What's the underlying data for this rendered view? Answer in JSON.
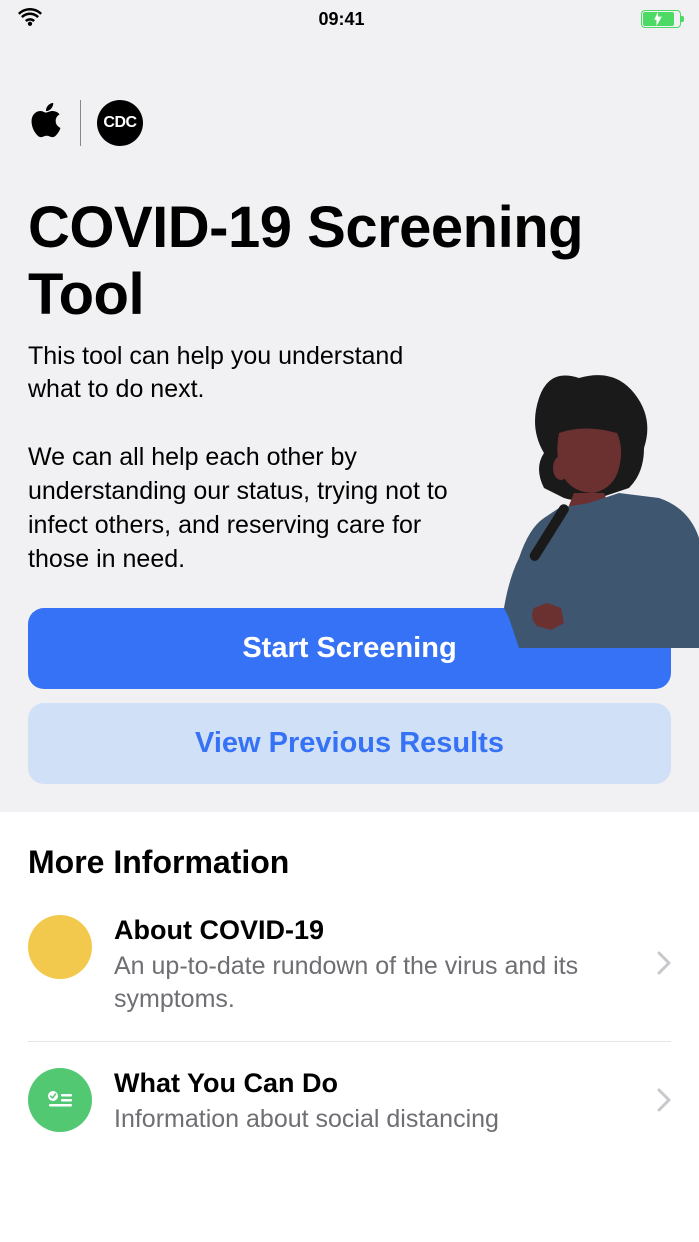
{
  "statusBar": {
    "time": "09:41"
  },
  "hero": {
    "title": "COVID-19 Screening Tool",
    "subtitle": "This tool can help you understand what to do next.",
    "description": "We can all help each other by understanding our status, trying not to infect others, and reserving care for those in need.",
    "primaryButton": "Start Screening",
    "secondaryButton": "View Previous Results"
  },
  "moreInfo": {
    "sectionTitle": "More Information",
    "items": [
      {
        "title": "About COVID-19",
        "description": "An up-to-date rundown of the virus and its symptoms.",
        "iconColor": "#F2C94C"
      },
      {
        "title": "What You Can Do",
        "description": "Information about social distancing",
        "iconColor": "#52C873"
      }
    ]
  }
}
